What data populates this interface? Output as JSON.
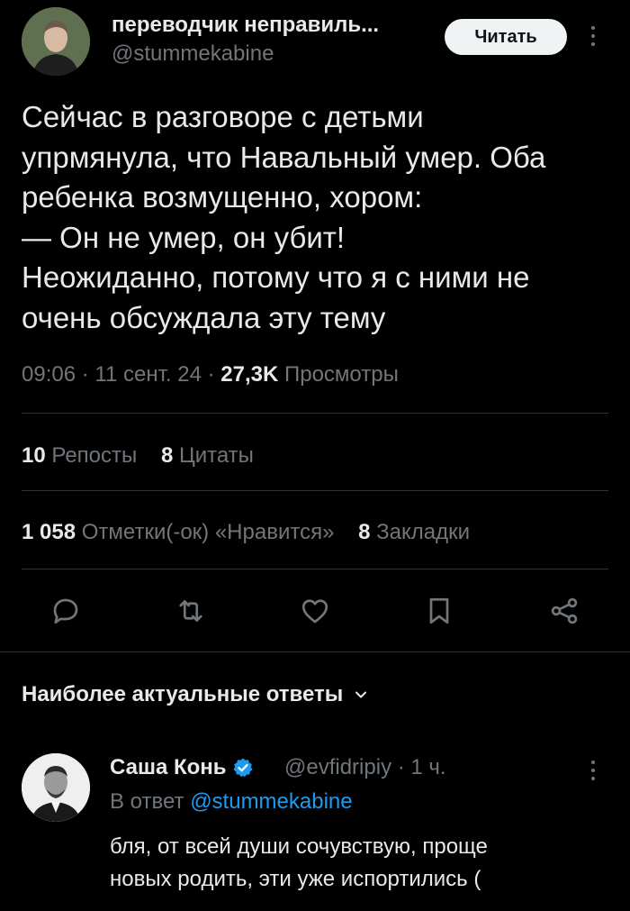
{
  "tweet": {
    "author_name": "переводчик неправиль...",
    "author_handle": "@stummekabine",
    "follow_label": "Читать",
    "text": "Сейчас в разговоре с детьми\nупрмянула, что Навальный умер. Оба\nребенка возмущенно, хором:\n— Он не умер, он убит!\nНеожиданно, потому что я с ними не\nочень обсуждала эту тему",
    "time": "09:06",
    "date": "11 сент. 24",
    "views_count": "27,3K",
    "views_label": "Просмотры",
    "sep": " · "
  },
  "stats": {
    "reposts_count": "10",
    "reposts_label": "Репосты",
    "quotes_count": "8",
    "quotes_label": "Цитаты",
    "likes_count": "1 058",
    "likes_label": "Отметки(-ок) «Нравится»",
    "bookmarks_count": "8",
    "bookmarks_label": "Закладки"
  },
  "actions": {
    "icons": [
      "reply-icon",
      "retweet-icon",
      "like-icon",
      "bookmark-icon",
      "share-icon"
    ]
  },
  "replies": {
    "heading": "Наиболее актуальные ответы",
    "items": [
      {
        "name": "Саша Конь",
        "handle": "@evfidripiy",
        "time": "1 ч.",
        "reply_to_prefix": "В ответ",
        "reply_to_handle": "@stummekabine",
        "text": "бля, от всей души сочувствую, проще\nновых родить, эти уже испортились ("
      }
    ]
  },
  "colors": {
    "background": "#000000",
    "text_primary": "#e7e9ea",
    "text_secondary": "#71767b",
    "link": "#1d9bf0",
    "divider": "#2f3336",
    "verified": "#1d9bf0"
  }
}
